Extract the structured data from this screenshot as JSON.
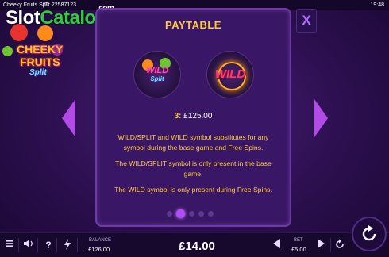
{
  "topbar": {
    "game_title": "Cheeky Fruits Split",
    "game_id": "ID: 22587123",
    "clock": "19:48"
  },
  "watermark": {
    "part1": "Slot",
    "part2": "Catalog",
    "suffix": ".com"
  },
  "logo": {
    "line1": "CHEEKY",
    "line2": "FRUITS",
    "line3": "Split"
  },
  "paytable": {
    "title": "PAYTABLE",
    "symbols": [
      {
        "name": "WILD/SPLIT",
        "line1": "WILD",
        "line2": "Split"
      },
      {
        "name": "WILD",
        "line1": "WILD"
      }
    ],
    "payout_key": "3:",
    "payout_value": "£125.00",
    "description": [
      "WILD/SPLIT and WILD symbol substitutes for any symbol during the base game and Free Spins.",
      "The WILD/SPLIT symbol is only present in the base game.",
      "The WILD symbol is only present during Free Spins."
    ],
    "page_count": 5,
    "active_page": 2
  },
  "close_label": "X",
  "bottom": {
    "balance_label": "BALANCE",
    "balance_value": "£126.00",
    "win_value": "£14.00",
    "bet_label": "BET",
    "bet_value": "£5.00"
  },
  "icons": {
    "menu": "menu-icon",
    "sound": "sound-icon",
    "help": "help-icon",
    "turbo": "lightning-icon",
    "bet_decrease": "triangle-left-icon",
    "bet_increase": "triangle-right-icon",
    "autoplay": "autoplay-icon",
    "spin": "spin-icon",
    "page_prev": "arrow-left-icon",
    "page_next": "arrow-right-icon"
  },
  "colors": {
    "accent": "#b24ae6",
    "gold": "#ffc93a",
    "panel": "#3a1766",
    "background": "#2c0f4f"
  }
}
